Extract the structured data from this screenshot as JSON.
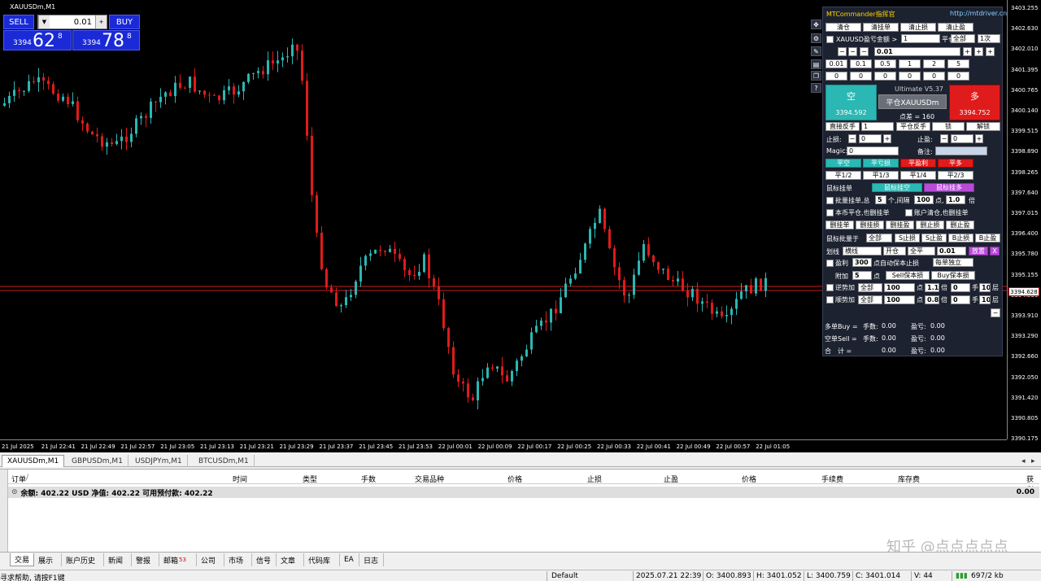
{
  "chart": {
    "symbol_title": "XAUUSDm,M1",
    "price_ticks": [
      "3403.255",
      "3402.630",
      "3402.010",
      "3401.395",
      "3400.765",
      "3400.140",
      "3399.515",
      "3398.890",
      "3398.265",
      "3397.640",
      "3397.015",
      "3396.400",
      "3395.780",
      "3395.155",
      "3394.530",
      "3393.910",
      "3393.290",
      "3392.660",
      "3392.050",
      "3391.420",
      "3390.805",
      "3390.175"
    ],
    "current_price": "3394.628",
    "time_ticks": [
      "21 Jul 2025",
      "21 Jul 22:41",
      "21 Jul 22:49",
      "21 Jul 22:57",
      "21 Jul 23:05",
      "21 Jul 23:13",
      "21 Jul 23:21",
      "21 Jul 23:29",
      "21 Jul 23:37",
      "21 Jul 23:45",
      "21 Jul 23:53",
      "22 Jul 00:01",
      "22 Jul 00:09",
      "22 Jul 00:17",
      "22 Jul 00:25",
      "22 Jul 00:33",
      "22 Jul 00:41",
      "22 Jul 00:49",
      "22 Jul 00:57",
      "22 Jul 01:05"
    ],
    "colors": {
      "bull": "#2bb7b3",
      "bear": "#e01b1b",
      "line": "#c81e1e",
      "bg": "#000000"
    }
  },
  "one_click": {
    "sell_label": "SELL",
    "buy_label": "BUY",
    "lot": "0.01",
    "sell_small": "3394",
    "sell_big": "62",
    "sell_sup": "8",
    "buy_small": "3394",
    "buy_big": "78",
    "buy_sup": "8"
  },
  "mtc": {
    "title": "MTCommander指挥官",
    "url": "http://mtdriver.cn",
    "row1": [
      "清仓",
      "清挂单",
      "清止损",
      "清止盈"
    ],
    "symbol_check_label": "XAUUSD盈亏金额 >",
    "amount": "1",
    "pingcang": "平仓",
    "all": "全部",
    "times": "1次",
    "lot": "0.01",
    "lot_presets": [
      "0.01",
      "0.1",
      "0.5",
      "1",
      "2",
      "5"
    ],
    "zero_row": [
      "0",
      "0",
      "0",
      "0",
      "0",
      "0"
    ],
    "version": "Ultimate V5.37",
    "short_label": "空",
    "short_price": "3394.592",
    "close_sym": "平仓XAUUSDm",
    "spread": "点差 = 160",
    "long_label": "多",
    "long_price": "3394.752",
    "reverse": "直接反手",
    "reverse_val": "1",
    "close_reverse": "平仓反手",
    "lock": "锁",
    "unlock": "解锁",
    "sl_label": "止损:",
    "sl_val": "0",
    "tp_label": "止盈:",
    "tp_val": "0",
    "magic_label": "Magic:",
    "magic_val": "0",
    "note_label": "备注:",
    "close_row": [
      "平空",
      "平亏损",
      "平盈利",
      "平多"
    ],
    "partial_row": [
      "平1/2",
      "平1/3",
      "平1/4",
      "平2/3"
    ],
    "mouse_pending": "鼠标挂单",
    "mouse_short": "鼠标挂空",
    "mouse_long": "鼠标挂多",
    "batch_label1": "批量挂单,总",
    "batch_count": "5",
    "batch_label2": "个,间隔",
    "batch_gap": "100",
    "batch_label3": "点,",
    "batch_mult": "1.0",
    "batch_label4": "倍",
    "check_a": "本币平仓,也删挂单",
    "check_b": "账户清仓,也删挂单",
    "del_row": [
      "删挂单",
      "删挂损",
      "删挂盈",
      "删止损",
      "删止盈"
    ],
    "mouse_batch": "鼠标批量于",
    "all2": "全部",
    "s_row": [
      "S止损",
      "S止盈",
      "B止损",
      "B止盈"
    ],
    "draw_label": "划线",
    "hline": "横线",
    "open": "开仓",
    "allclose": "全平",
    "draw_lot": "0.01",
    "place": "放置",
    "x": "X",
    "profit_label": "盈利",
    "profit_val": "300",
    "profit_text": "点自动保本止损",
    "each_indep": "每单独立",
    "add_label": "附加",
    "add_val": "5",
    "add_unit": "点",
    "sell_be": "Sell保本损",
    "buy_be": "Buy保本损",
    "counter_label": "逆势加",
    "pro_label": "顺势加",
    "all3": "全部",
    "c_pts": "100",
    "c_pt": "点",
    "c_mult": "1.1",
    "p_mult": "0.8",
    "c_bei": "倍",
    "c_lots": "0",
    "c_shou": "手",
    "c_layers": "10",
    "c_ceng": "层",
    "minus": "−",
    "buy_sum": "多单Buy =",
    "sell_sum": "空单Sell =",
    "total_sum": "合　计 =",
    "lots_lbl": "手数:",
    "pl_lbl": "盈亏:",
    "buy_lots": "0.00",
    "buy_pl": "0.00",
    "sell_lots": "0.00",
    "sell_pl": "0.00",
    "total_lots": "0.00",
    "total_pl": "0.00"
  },
  "chart_tabs": [
    "XAUUSDm,M1",
    "GBPUSDm,M1",
    "USDJPYm,M1",
    "BTCUSDm,M1"
  ],
  "terminal": {
    "headers": [
      "订单",
      "/",
      "时间",
      "类型",
      "手数",
      "交易品种",
      "价格",
      "止损",
      "止盈",
      "价格",
      "手续费",
      "库存费",
      "获利"
    ],
    "balance": "余额: 402.22 USD  净值: 402.22  可用预付款: 402.22",
    "profit": "0.00"
  },
  "bottom_tabs": [
    "交易",
    "展示",
    "账户历史",
    "新闻",
    "警报",
    "邮箱",
    "公司",
    "市场",
    "信号",
    "文章",
    "代码库",
    "EA",
    "日志"
  ],
  "mail_count": "53",
  "watermark": "知乎 @点点点点点",
  "status": {
    "help": "寻求帮助, 请按F1键",
    "profile": "Default",
    "datetime": "2025.07.21 22:39",
    "open": "O: 3400.893",
    "high": "H: 3401.052",
    "low": "L: 3400.759",
    "close": "C: 3401.014",
    "volume": "V: 44",
    "traffic": "697/2 kb"
  }
}
